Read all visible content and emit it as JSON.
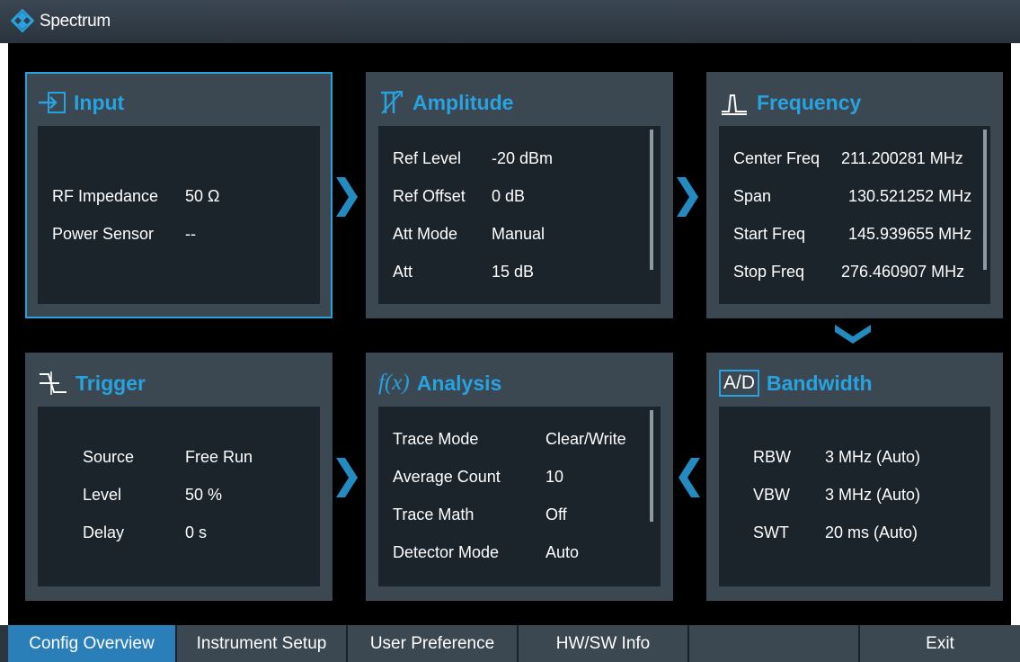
{
  "app": {
    "title": "Spectrum",
    "logo_icon": "rohde-schwarz-diamond-icon"
  },
  "colors": {
    "accent": "#29a3e0",
    "panel": "#3b4751",
    "panel_inner": "#1c242b",
    "background": "#000000"
  },
  "panels": {
    "input": {
      "title": "Input",
      "icon": "input-arrow-icon",
      "rows": [
        {
          "label": "RF Impedance",
          "value": "50 Ω"
        },
        {
          "label": "Power Sensor",
          "value": "--"
        }
      ]
    },
    "amplitude": {
      "title": "Amplitude",
      "icon": "amplitude-icon",
      "rows": [
        {
          "label": "Ref Level",
          "value": "-20 dBm"
        },
        {
          "label": "Ref Offset",
          "value": "0 dB"
        },
        {
          "label": "Att Mode",
          "value": "Manual"
        },
        {
          "label": "Att",
          "value": "15 dB"
        }
      ]
    },
    "frequency": {
      "title": "Frequency",
      "icon": "frequency-peak-icon",
      "rows": [
        {
          "label": "Center Freq",
          "value": "211.200281 MHz"
        },
        {
          "label": "Span",
          "value": "130.521252 MHz"
        },
        {
          "label": "Start Freq",
          "value": "145.939655 MHz"
        },
        {
          "label": "Stop Freq",
          "value": "276.460907 MHz"
        }
      ]
    },
    "trigger": {
      "title": "Trigger",
      "icon": "trigger-edge-icon",
      "rows": [
        {
          "label": "Source",
          "value": "Free Run"
        },
        {
          "label": "Level",
          "value": "50 %"
        },
        {
          "label": "Delay",
          "value": "0 s"
        }
      ]
    },
    "analysis": {
      "title": "Analysis",
      "icon_text": "f(x)",
      "rows": [
        {
          "label": "Trace Mode",
          "value": "Clear/Write"
        },
        {
          "label": "Average Count",
          "value": "10"
        },
        {
          "label": "Trace Math",
          "value": "Off"
        },
        {
          "label": "Detector Mode",
          "value": "Auto"
        }
      ]
    },
    "bandwidth": {
      "title": "Bandwidth",
      "icon_text": "A/D",
      "rows": [
        {
          "label": "RBW",
          "value": "3 MHz (Auto)"
        },
        {
          "label": "VBW",
          "value": "3 MHz (Auto)"
        },
        {
          "label": "SWT",
          "value": "20 ms (Auto)"
        }
      ]
    }
  },
  "softkeys": [
    {
      "label": "Config Overview",
      "active": true
    },
    {
      "label": "Instrument Setup",
      "active": false
    },
    {
      "label": "User Preference",
      "active": false
    },
    {
      "label": "HW/SW Info",
      "active": false
    },
    {
      "label": "",
      "active": false
    },
    {
      "label": "Exit",
      "active": false
    }
  ]
}
